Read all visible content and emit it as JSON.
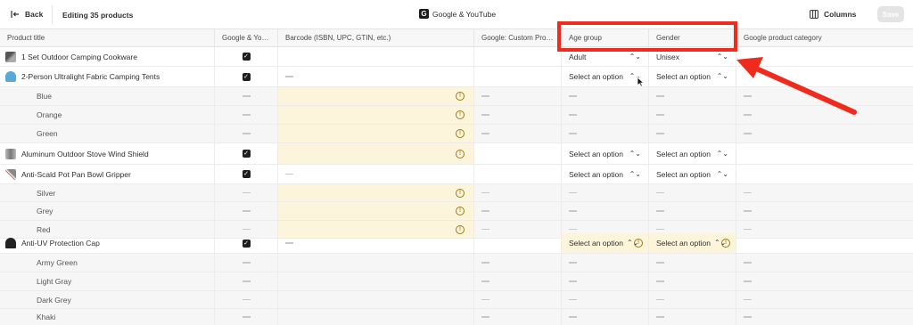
{
  "topbar": {
    "back_label": "Back",
    "title": "Editing 35 products",
    "channel": "Google & YouTube",
    "channel_icon_letter": "G",
    "columns_label": "Columns",
    "save_label": "Save"
  },
  "columns": [
    "Product title",
    "Google & Yo…",
    "Barcode (ISBN, UPC, GTIN, etc.)",
    "Google: Custom Pro…",
    "Age group",
    "Gender",
    "Google product category"
  ],
  "rows": [
    {
      "title": "1 Set Outdoor Camping Cookware",
      "age": "Adult",
      "gender": "Unisex"
    },
    {
      "title": "2-Person Ultralight Fabric Camping Tents",
      "age": "Select an option",
      "gender": "Select an option"
    },
    {
      "title": "Blue"
    },
    {
      "title": "Orange"
    },
    {
      "title": "Green"
    },
    {
      "title": "Aluminum Outdoor Stove Wind Shield",
      "age": "Select an option",
      "gender": "Select an option"
    },
    {
      "title": "Anti-Scald Pot Pan Bowl Gripper",
      "age": "Select an option",
      "gender": "Select an option"
    },
    {
      "title": "Silver"
    },
    {
      "title": "Grey"
    },
    {
      "title": "Red"
    },
    {
      "title": "Anti-UV Protection Cap",
      "age": "Select an option",
      "gender": "Select an option"
    },
    {
      "title": "Army Green"
    },
    {
      "title": "Light Gray"
    },
    {
      "title": "Dark Grey"
    },
    {
      "title": "Khaki"
    }
  ],
  "colors": {
    "highlight": "#ef2b1e",
    "warning_fill": "#fcf5dc",
    "warning_icon": "#9c7a14"
  }
}
